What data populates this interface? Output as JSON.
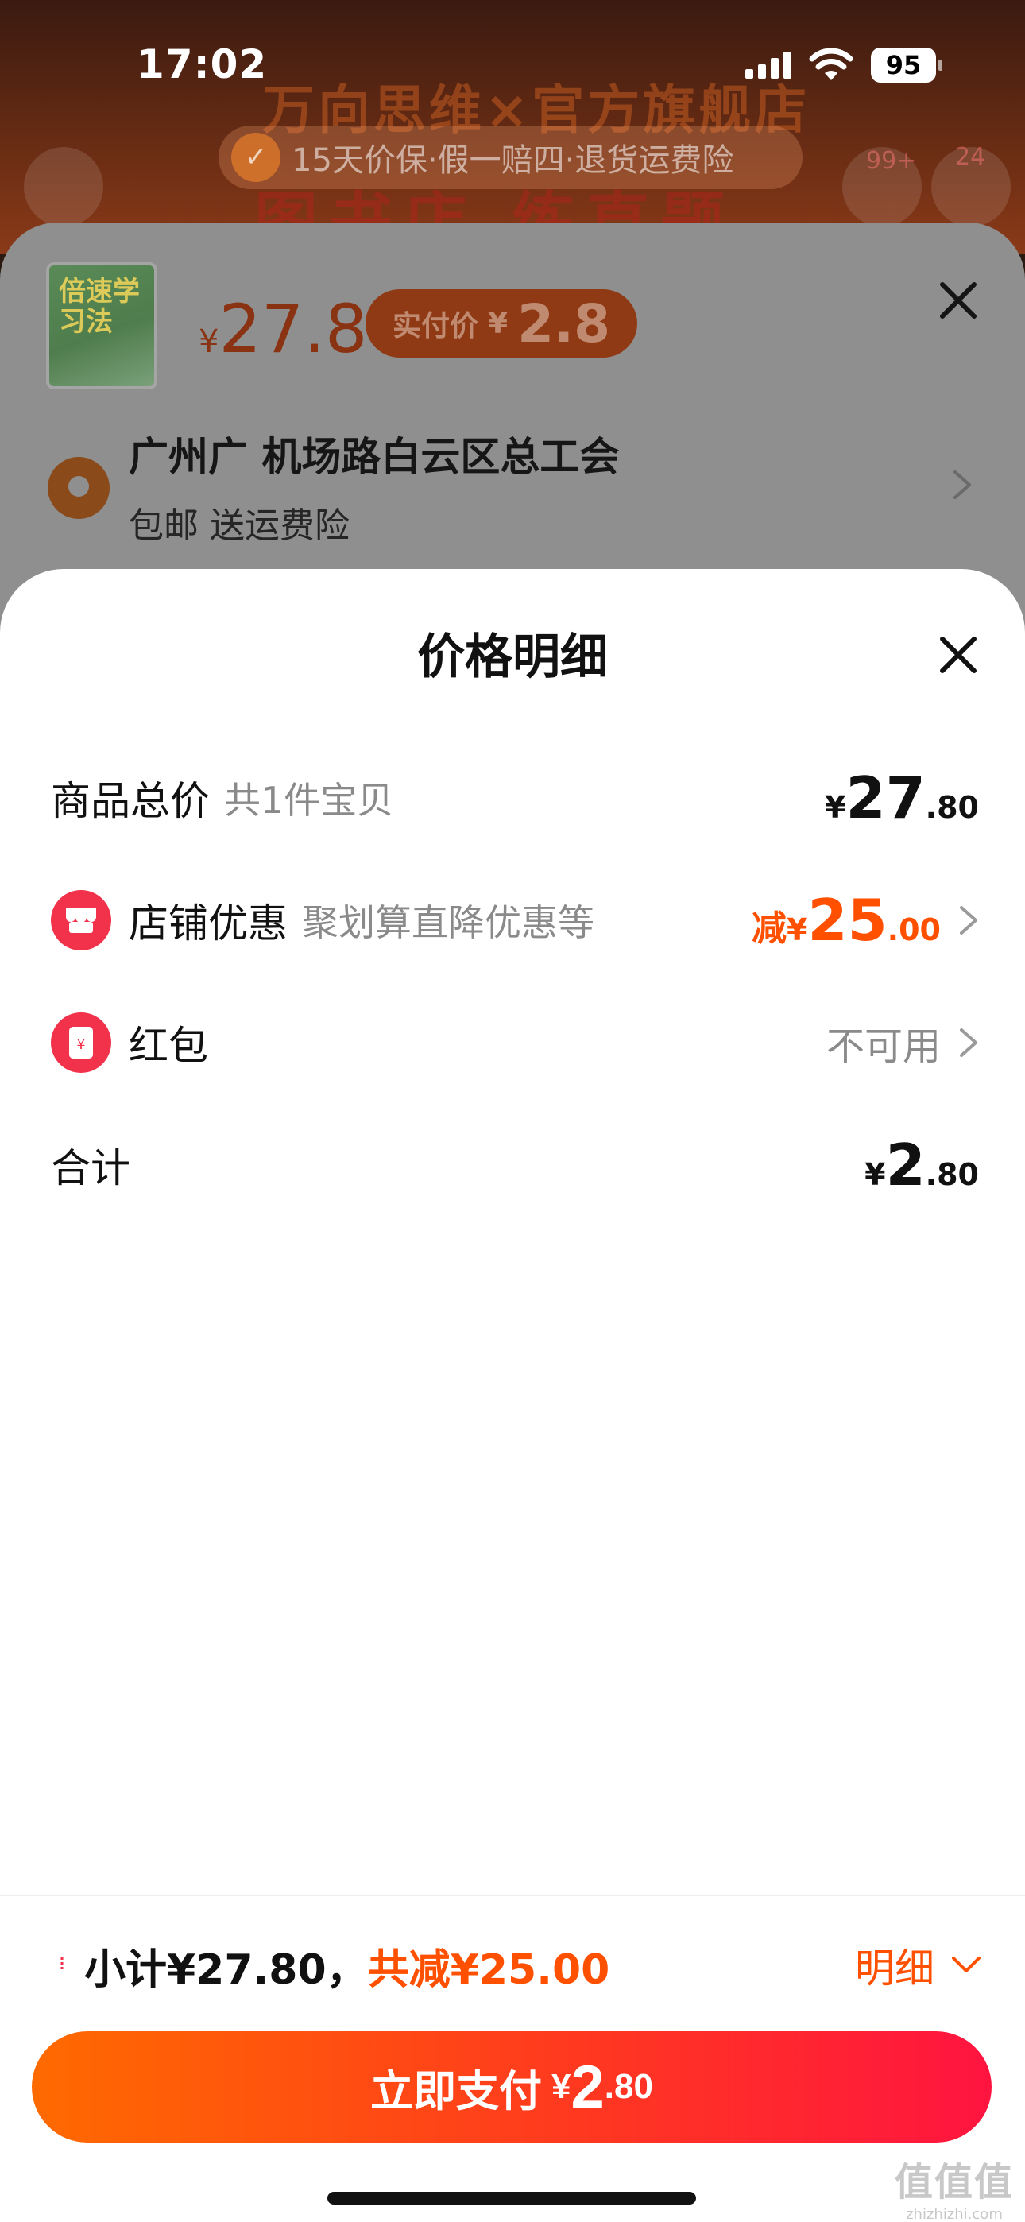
{
  "status_bar": {
    "time": "17:02",
    "battery": "95"
  },
  "background_store": {
    "banner": "万向思维×官方旗舰店",
    "banner2": "图书店 练直题",
    "guarantee": "15天价保·假一赔四·退货运费险",
    "cart_count": "99+",
    "msg_count": "24"
  },
  "product_sheet": {
    "thumb_title": "倍速学习法",
    "price_yen": "¥",
    "price": "27.8",
    "real_pay_label": "实付价",
    "real_pay_yen": "¥",
    "real_pay": "2.8",
    "address": "广州广 机场路白云区总工会",
    "shipping": "包邮 送运费险"
  },
  "price_detail": {
    "title": "价格明细",
    "rows": [
      {
        "label": "商品总价",
        "sub": "共1件宝贝",
        "yen": "¥",
        "int": "27",
        "dec": ".80"
      },
      {
        "label": "店铺优惠",
        "sub": "聚划算直降优惠等",
        "prefix": "减",
        "yen": "¥",
        "int": "25",
        "dec": ".00"
      },
      {
        "label": "红包",
        "value": "不可用"
      },
      {
        "label": "合计",
        "yen": "¥",
        "int": "2",
        "dec": ".80"
      }
    ]
  },
  "bottom": {
    "subtotal": "小计¥27.80，",
    "discount": "共减¥25.00",
    "detail_label": "明细",
    "pay_label": "立即支付",
    "pay_yen": "¥",
    "pay_int": "2",
    "pay_dec": ".80"
  },
  "watermark": {
    "main": "值值值",
    "sub": "zhizhizhi.com"
  },
  "colors": {
    "accent": "#ff5000",
    "coupon_red": "#f2324a",
    "pay_gradient_start": "#ff6a00",
    "pay_gradient_end": "#ff1440"
  }
}
